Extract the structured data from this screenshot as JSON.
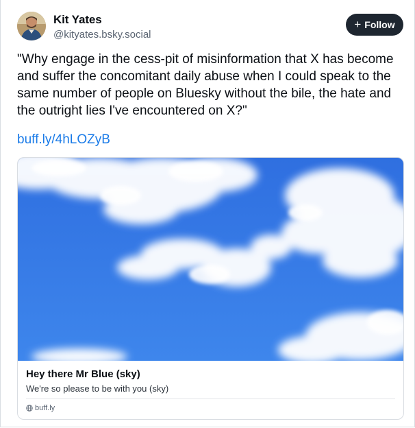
{
  "author": {
    "display_name": "Kit Yates",
    "handle": "@kityates.bsky.social",
    "avatar_icon": "avatar"
  },
  "follow_button": {
    "label": "Follow",
    "icon": "plus-icon"
  },
  "post": {
    "text": "\"Why engage in the cess-pit of misinformation that X has become and suffer the concomitant daily abuse when I could speak to the same number of people on Bluesky without the bile, the hate and the outright lies I've encountered on X?\"",
    "link": "buff.ly/4hLOZyB"
  },
  "link_card": {
    "title": "Hey there Mr Blue (sky)",
    "description": "We're so please to be with you (sky)",
    "domain": "buff.ly",
    "domain_icon": "globe-icon"
  },
  "colors": {
    "link": "#1a7be8",
    "follow_bg": "#1e2630",
    "sky_top": "#2f6fe0",
    "sky_bottom": "#3e86ec"
  }
}
